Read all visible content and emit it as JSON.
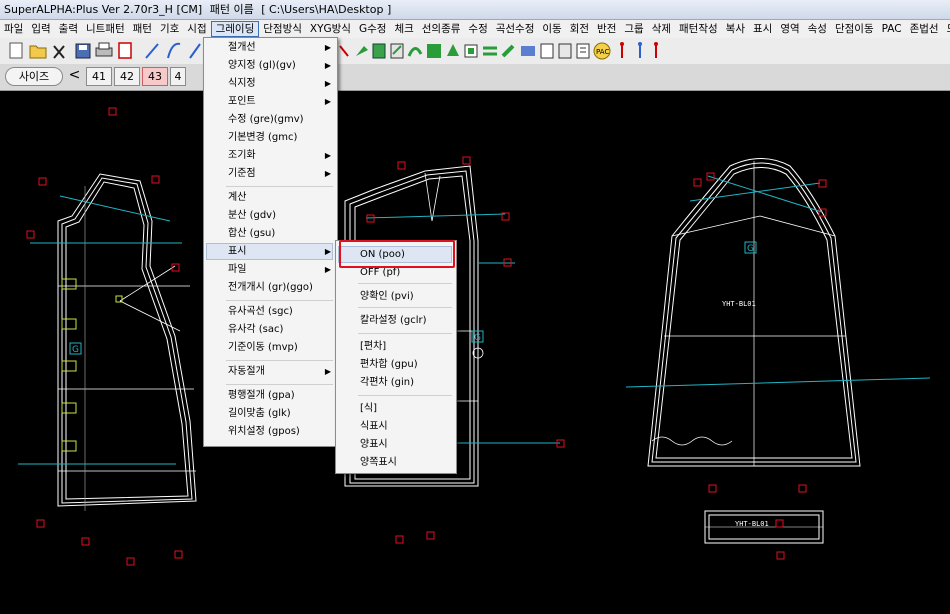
{
  "window": {
    "title_app": "SuperALPHA:Plus Ver 2.70r3_H [CM]",
    "title_doc_label": "패턴 이름",
    "title_path": "[ C:\\Users\\HA\\Desktop ]"
  },
  "menubar": {
    "items": [
      "파일",
      "입력",
      "출력",
      "니트패턴",
      "패턴",
      "기호",
      "시접",
      "그레이딩",
      "단점방식",
      "XYG방식",
      "G수정",
      "체크",
      "선의종류",
      "수정",
      "곡선수정",
      "이동",
      "회전",
      "반전",
      "그룹",
      "삭제",
      "패턴작성",
      "복사",
      "표시",
      "영역",
      "속성",
      "단점이동",
      "PAC",
      "존법선",
      "도움말"
    ],
    "active": "그레이딩"
  },
  "sizebar": {
    "label": "사이즈",
    "prev_symbol": "<",
    "sizes": [
      "41",
      "42",
      "43",
      "4"
    ],
    "selected": "43"
  },
  "grading_menu": {
    "items": [
      {
        "label": "절개선",
        "submenu": true
      },
      {
        "label": "양지정 (gl)(gv)",
        "submenu": true
      },
      {
        "label": "식지정",
        "submenu": true
      },
      {
        "label": "포인트",
        "submenu": true
      },
      {
        "label": "수정 (gre)(gmv)",
        "submenu": false
      },
      {
        "label": "기본변경 (gmc)",
        "submenu": false
      },
      {
        "label": "조기화",
        "submenu": true
      },
      {
        "label": "기준점",
        "submenu": true
      },
      {
        "label": "계산",
        "submenu": false
      },
      {
        "label": "분산 (gdv)",
        "submenu": false
      },
      {
        "label": "합산 (gsu)",
        "submenu": false
      },
      {
        "label": "표시",
        "submenu": true
      },
      {
        "label": "파일",
        "submenu": true
      },
      {
        "label": "전개개시 (gr)(ggo)",
        "submenu": false
      },
      {
        "label": "유사곡선 (sgc)",
        "submenu": false
      },
      {
        "label": "유사각 (sac)",
        "submenu": false
      },
      {
        "label": "기준이동 (mvp)",
        "submenu": false
      },
      {
        "label": "자동절개",
        "submenu": true
      },
      {
        "label": "평행절개 (gpa)",
        "submenu": false
      },
      {
        "label": "길이맞춤 (glk)",
        "submenu": false
      },
      {
        "label": "위치설정 (gpos)",
        "submenu": false
      }
    ],
    "highlighted": "표시"
  },
  "display_submenu": {
    "items": [
      "ON  (poo)",
      "OFF  (pf)",
      "양확인 (pvi)",
      "칼라설정 (gclr)",
      "[편차]",
      "편차합 (gpu)",
      "각편차 (gin)",
      "[식]",
      "식표시",
      "양표시",
      "양쪽표시"
    ],
    "highlighted": "ON  (poo)"
  },
  "canvas": {
    "grade_marker": "G",
    "pattern_labels": [
      "YHT-BL01",
      "YHT-BL01"
    ],
    "colors": {
      "background": "#000000",
      "pattern_line": "#ffffff",
      "grade_line": "#1fb4c4",
      "point_marker": "#e0101f",
      "notch_marker": "#c8e640"
    }
  },
  "annotation": {
    "color": "#e0101f",
    "target": "ON  (poo)"
  }
}
